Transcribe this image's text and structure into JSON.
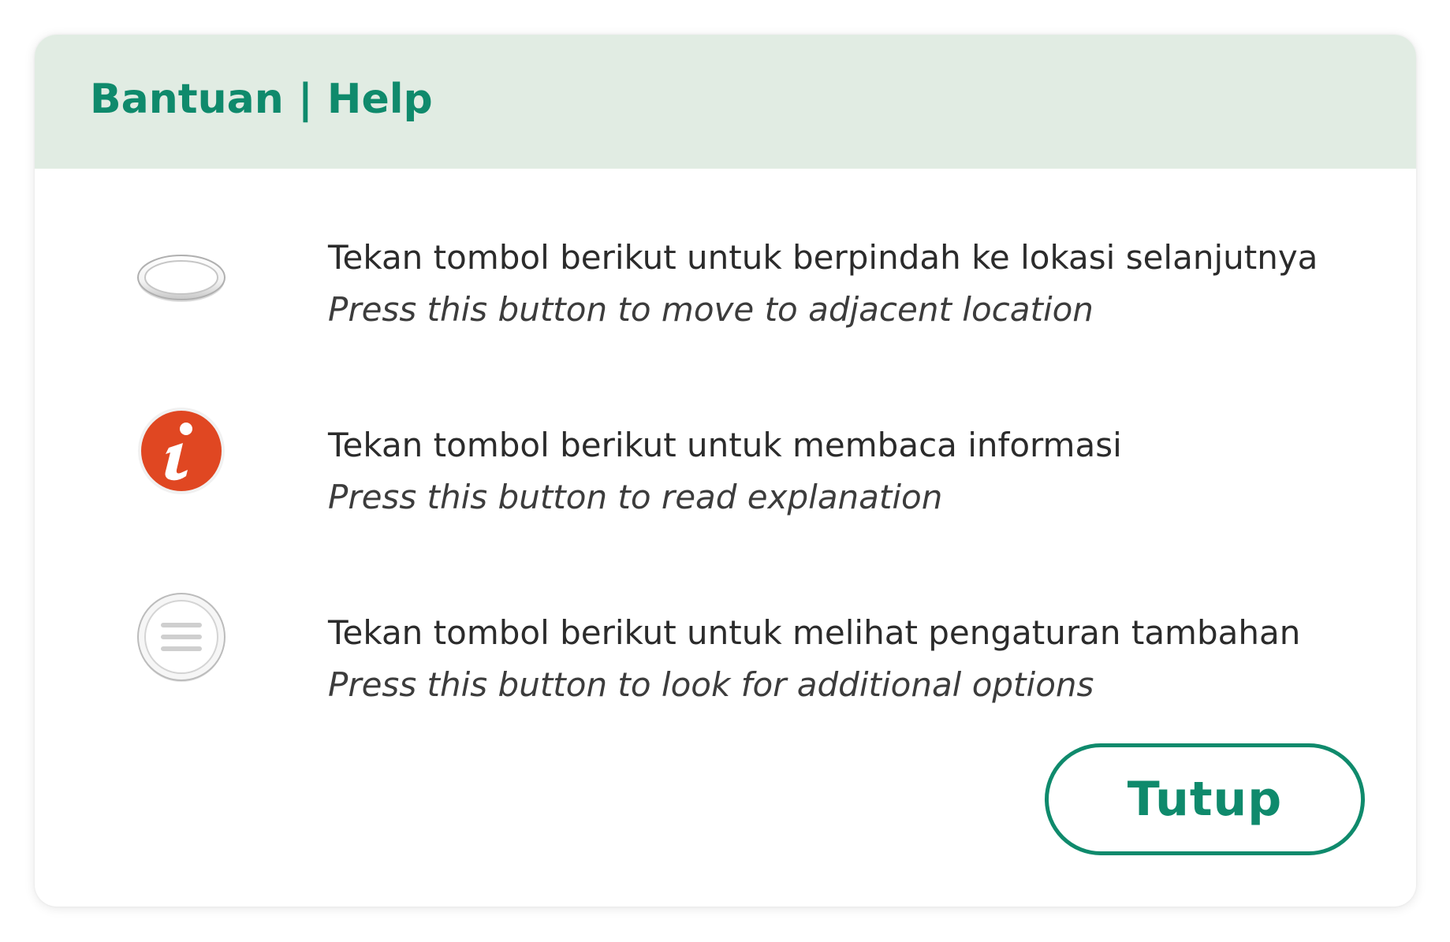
{
  "dialog": {
    "title": "Bantuan | Help",
    "items": [
      {
        "icon": "navigation-ring-icon",
        "primary": "Tekan tombol berikut untuk berpindah ke lokasi selanjutnya",
        "secondary": "Press this button to move to adjacent location"
      },
      {
        "icon": "info-icon",
        "primary": "Tekan tombol berikut untuk membaca informasi",
        "secondary": "Press this button to read explanation"
      },
      {
        "icon": "menu-icon",
        "primary": "Tekan tombol berikut untuk melihat pengaturan tambahan",
        "secondary": "Press this button to look for additional options"
      }
    ],
    "close_label": "Tutup"
  },
  "colors": {
    "accent": "#0f8a6c",
    "header_bg": "#e1ece3",
    "info_red": "#e04722"
  }
}
